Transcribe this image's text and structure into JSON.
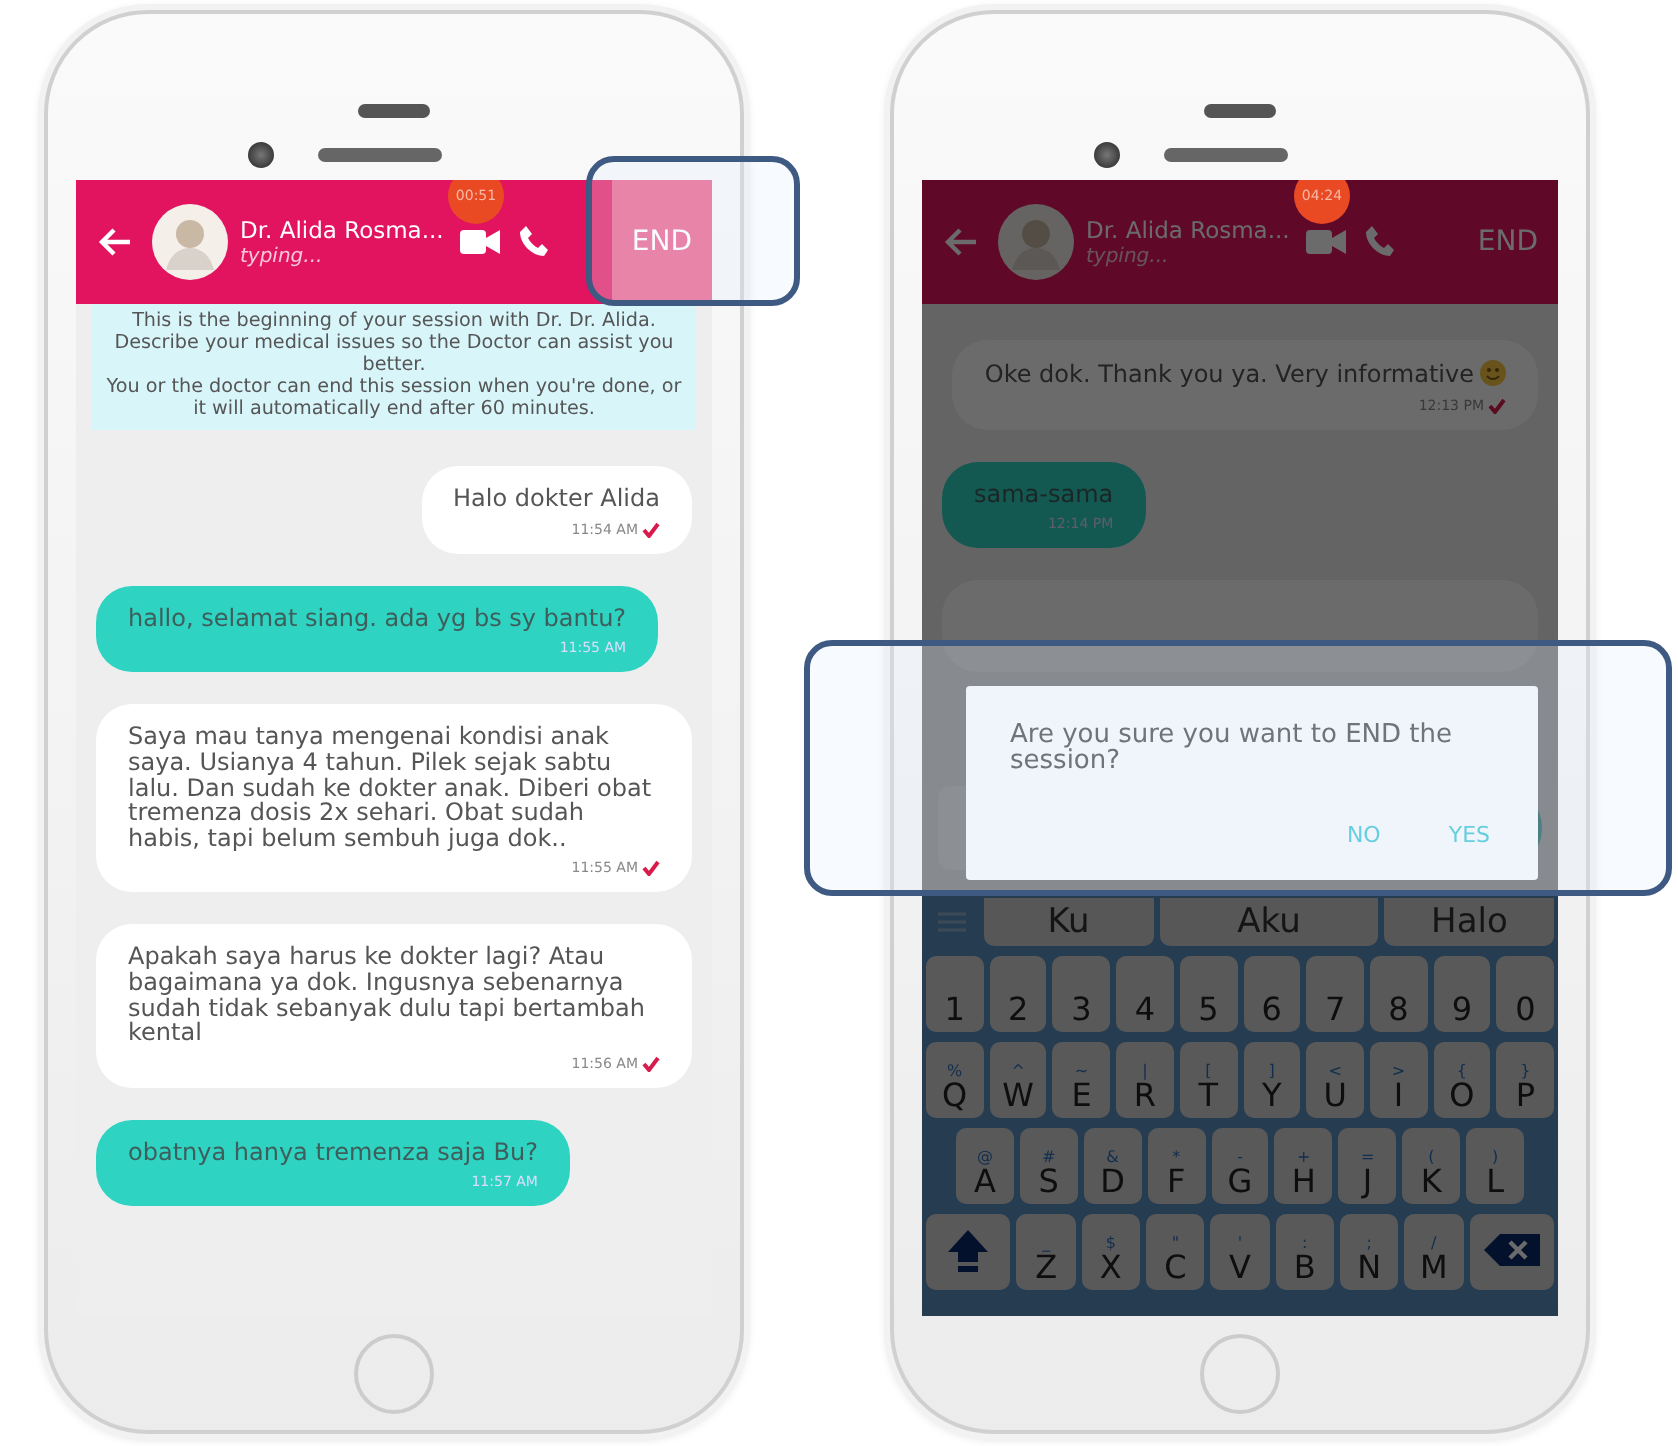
{
  "phones": [
    {
      "screen": {
        "timer": "00:51",
        "dimmed": false,
        "header": {
          "name": "Dr. Alida Rosma...",
          "status": "typing...",
          "end_label": "END",
          "end_pressed": true,
          "end_highlighted": true
        },
        "notice": "This is the beginning of your session with Dr. Dr. Alida.\nDescribe your medical issues so the Doctor can assist you better.\nYou or the doctor can end this session when you're done, or it will automatically end after 60 minutes.",
        "messages": [
          {
            "kind": "sent",
            "text": "Halo dokter Alida",
            "time": "11:54 AM",
            "read": true,
            "emoji": false
          },
          {
            "kind": "received",
            "text": "hallo, selamat siang. ada yg bs sy bantu?",
            "time": "11:55 AM"
          },
          {
            "kind": "sent",
            "text": "Saya mau tanya mengenai kondisi anak saya. Usianya 4 tahun. Pilek sejak sabtu lalu. Dan sudah ke dokter anak. Diberi obat tremenza dosis 2x sehari. Obat sudah habis, tapi belum sembuh juga dok..",
            "time": "11:55 AM",
            "read": true,
            "emoji": false
          },
          {
            "kind": "sent",
            "text": "Apakah saya harus ke dokter lagi? Atau bagaimana ya dok. Ingusnya sebenarnya sudah tidak sebanyak dulu tapi bertambah kental",
            "time": "11:56 AM",
            "read": true,
            "emoji": false
          },
          {
            "kind": "received",
            "text": "obatnya hanya tremenza saja Bu?",
            "time": "11:57 AM"
          }
        ]
      }
    },
    {
      "screen": {
        "timer": "04:24",
        "dimmed": true,
        "header": {
          "name": "Dr. Alida Rosma...",
          "status": "typing...",
          "end_label": "END",
          "end_pressed": false,
          "end_highlighted": false
        },
        "messages": [
          {
            "kind": "sent",
            "text": "Oke dok. Thank you ya. Very informative",
            "time": "12:13 PM",
            "read": true,
            "emoji": true
          },
          {
            "kind": "received",
            "text": "sama-sama",
            "time": "12:14 PM"
          },
          {
            "kind": "hidden"
          }
        ],
        "composer": {
          "send_button": true
        },
        "keyboard": {
          "suggestions": [
            "Ku",
            "Aku",
            "Halo"
          ],
          "rows": [
            {
              "keys": [
                {
                  "kind": "char",
                  "label": "1"
                },
                {
                  "kind": "char",
                  "label": "2"
                },
                {
                  "kind": "char",
                  "label": "3"
                },
                {
                  "kind": "char",
                  "label": "4"
                },
                {
                  "kind": "char",
                  "label": "5"
                },
                {
                  "kind": "char",
                  "label": "6"
                },
                {
                  "kind": "char",
                  "label": "7"
                },
                {
                  "kind": "char",
                  "label": "8"
                },
                {
                  "kind": "char",
                  "label": "9"
                },
                {
                  "kind": "char",
                  "label": "0"
                }
              ]
            },
            {
              "keys": [
                {
                  "kind": "char",
                  "label": "Q",
                  "sub": "%"
                },
                {
                  "kind": "char",
                  "label": "W",
                  "sub": "^"
                },
                {
                  "kind": "char",
                  "label": "E",
                  "sub": "~"
                },
                {
                  "kind": "char",
                  "label": "R",
                  "sub": "|"
                },
                {
                  "kind": "char",
                  "label": "T",
                  "sub": "["
                },
                {
                  "kind": "char",
                  "label": "Y",
                  "sub": "]"
                },
                {
                  "kind": "char",
                  "label": "U",
                  "sub": "<"
                },
                {
                  "kind": "char",
                  "label": "I",
                  "sub": ">"
                },
                {
                  "kind": "char",
                  "label": "O",
                  "sub": "{"
                },
                {
                  "kind": "char",
                  "label": "P",
                  "sub": "}"
                }
              ]
            },
            {
              "keys": [
                {
                  "kind": "char",
                  "label": "A",
                  "sub": "@"
                },
                {
                  "kind": "char",
                  "label": "S",
                  "sub": "#"
                },
                {
                  "kind": "char",
                  "label": "D",
                  "sub": "&"
                },
                {
                  "kind": "char",
                  "label": "F",
                  "sub": "*"
                },
                {
                  "kind": "char",
                  "label": "G",
                  "sub": "-"
                },
                {
                  "kind": "char",
                  "label": "H",
                  "sub": "+"
                },
                {
                  "kind": "char",
                  "label": "J",
                  "sub": "="
                },
                {
                  "kind": "char",
                  "label": "K",
                  "sub": "("
                },
                {
                  "kind": "char",
                  "label": "L",
                  "sub": ")"
                }
              ]
            },
            {
              "keys": [
                {
                  "kind": "shift"
                },
                {
                  "kind": "char",
                  "label": "Z",
                  "sub": "_"
                },
                {
                  "kind": "char",
                  "label": "X",
                  "sub": "$"
                },
                {
                  "kind": "char",
                  "label": "C",
                  "sub": "\""
                },
                {
                  "kind": "char",
                  "label": "V",
                  "sub": "'"
                },
                {
                  "kind": "char",
                  "label": "B",
                  "sub": ":"
                },
                {
                  "kind": "char",
                  "label": "N",
                  "sub": ";"
                },
                {
                  "kind": "char",
                  "label": "M",
                  "sub": "/"
                },
                {
                  "kind": "backspace"
                }
              ]
            }
          ]
        },
        "dialog": {
          "text": "Are you sure you want to END the session?",
          "buttons": [
            "NO",
            "YES"
          ],
          "highlighted": true
        }
      }
    }
  ]
}
